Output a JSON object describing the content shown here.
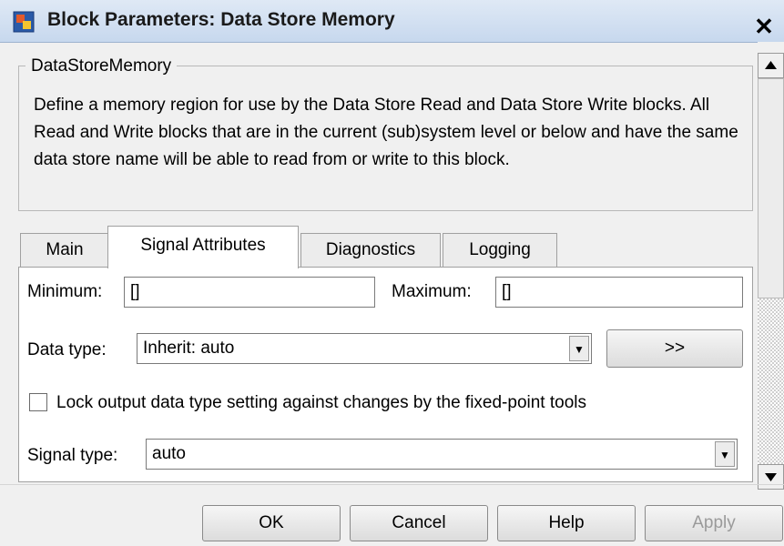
{
  "window": {
    "title": "Block Parameters: Data Store Memory",
    "close_label": "✕"
  },
  "description": {
    "group_label": "DataStoreMemory",
    "text": "Define a memory region for use by the Data Store Read and Data Store Write blocks. All Read and Write blocks that are in the current (sub)system level or below and have the same data store name will be able to read from or write to this block."
  },
  "tabs": [
    {
      "label": "Main",
      "active": false
    },
    {
      "label": "Signal Attributes",
      "active": true
    },
    {
      "label": "Diagnostics",
      "active": false
    },
    {
      "label": "Logging",
      "active": false
    }
  ],
  "signal_attributes": {
    "minimum_label": "Minimum:",
    "minimum_value": "[]",
    "maximum_label": "Maximum:",
    "maximum_value": "[]",
    "data_type_label": "Data type:",
    "data_type_value": "Inherit: auto",
    "data_type_assistant_label": ">>",
    "lock_label": "Lock output data type setting against changes by the fixed-point tools",
    "lock_checked": false,
    "signal_type_label": "Signal type:",
    "signal_type_value": "auto"
  },
  "buttons": {
    "ok": "OK",
    "cancel": "Cancel",
    "help": "Help",
    "apply": "Apply"
  },
  "icons": {
    "app": "simulink-block-icon",
    "close": "close-icon",
    "dropdown": "chevron-down-icon",
    "scroll_up": "arrow-up-icon",
    "scroll_down": "arrow-down-icon"
  }
}
